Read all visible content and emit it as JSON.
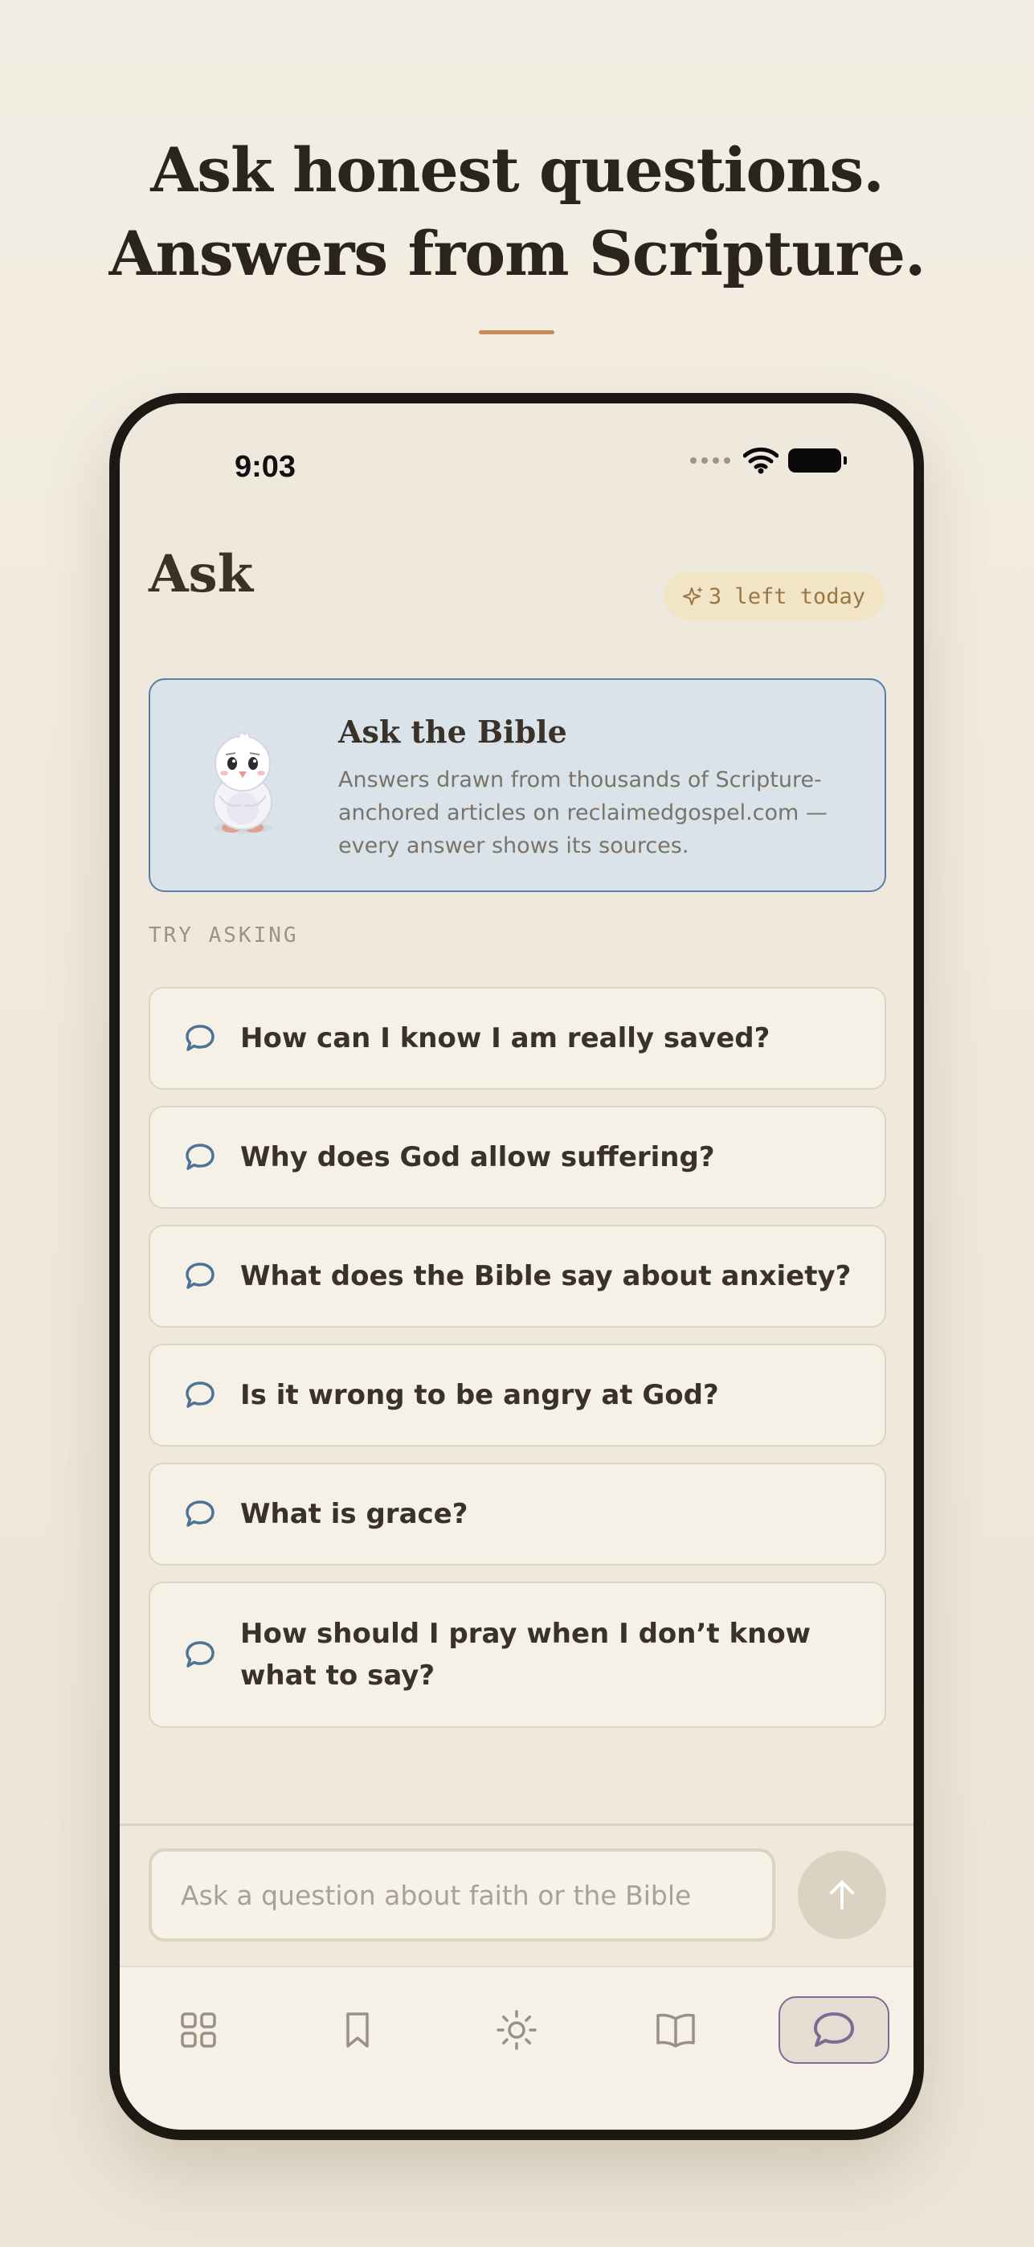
{
  "headline": {
    "line1": "Ask honest questions.",
    "line2": "Answers from Scripture."
  },
  "status_bar": {
    "time": "9:03"
  },
  "screen": {
    "title": "Ask",
    "quota": "3 left today"
  },
  "ask_card": {
    "title": "Ask the Bible",
    "body_line1": "Answers drawn from thousands of Scripture-",
    "body_line2": "anchored articles on reclaimedgospel.com —",
    "body_line3": "every answer shows its sources."
  },
  "try_label": "TRY ASKING",
  "questions": [
    "How can I know I am really saved?",
    "Why does God allow suffering?",
    "What does the Bible say about anxiety?",
    "Is it wrong to be angry at God?",
    "What is grace?",
    "How should I pray when I don’t know what to say?"
  ],
  "composer": {
    "placeholder": "Ask a question about faith or the Bible"
  },
  "tabs": [
    {
      "icon": "grid-icon",
      "active": false
    },
    {
      "icon": "bookmark-icon",
      "active": false
    },
    {
      "icon": "sun-icon",
      "active": false
    },
    {
      "icon": "book-icon",
      "active": false
    },
    {
      "icon": "chat-icon",
      "active": true
    }
  ],
  "colors": {
    "accent": "#c98a5b",
    "card_border": "#5a7fa3",
    "card_bg": "#dae3ea",
    "active_tab_border": "#7f6b91",
    "quota_text": "#9a7645"
  }
}
